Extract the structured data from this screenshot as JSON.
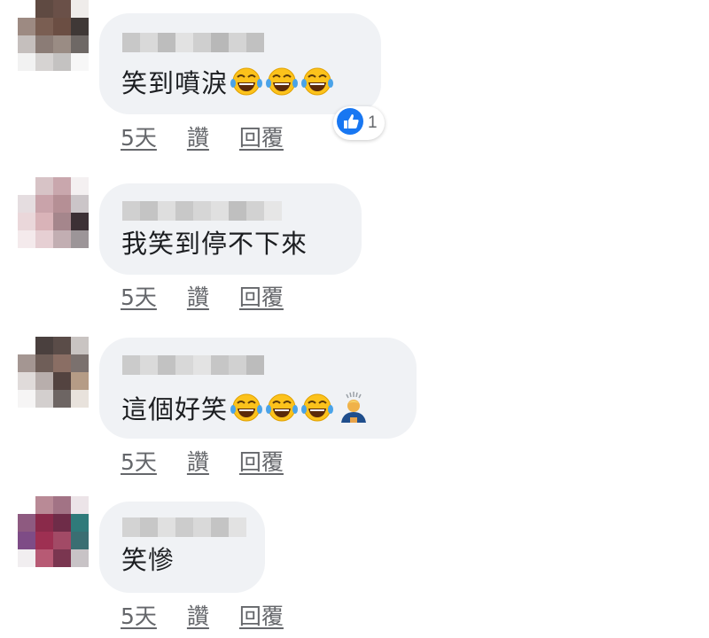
{
  "comments": [
    {
      "text": "笑到噴淚",
      "emojis": [
        "laughing-tears",
        "laughing-tears",
        "laughing-tears"
      ],
      "time": "5天",
      "like_label": "讚",
      "reply_label": "回覆",
      "reaction": {
        "icon": "thumbs-up-icon",
        "count": "1",
        "color": "#1877f2"
      }
    },
    {
      "text": "我笑到停不下來",
      "emojis": [],
      "time": "5天",
      "like_label": "讚",
      "reply_label": "回覆"
    },
    {
      "text": "這個好笑",
      "emojis": [
        "laughing-tears",
        "laughing-tears",
        "laughing-tears",
        "bowing-person"
      ],
      "time": "5天",
      "like_label": "讚",
      "reply_label": "回覆"
    },
    {
      "text": "笑慘",
      "emojis": [],
      "time": "5天",
      "like_label": "讚",
      "reply_label": "回覆"
    }
  ],
  "colors": {
    "bubble": "#f0f2f5",
    "text": "#1c1e21",
    "meta": "#65676b",
    "like_blue": "#1877f2"
  }
}
